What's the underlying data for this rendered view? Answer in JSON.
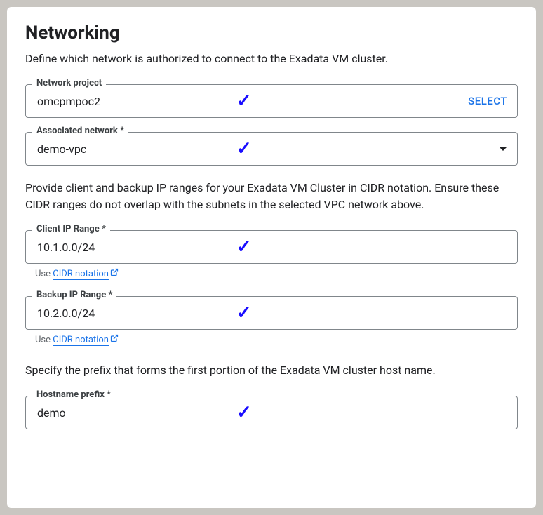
{
  "title": "Networking",
  "intro": "Define which network is authorized to connect to the Exadata VM cluster.",
  "fields": {
    "network_project": {
      "label": "Network project",
      "value": "omcpmpoc2",
      "action": "SELECT"
    },
    "associated_network": {
      "label": "Associated network *",
      "value": "demo-vpc"
    }
  },
  "cidr_intro": "Provide client and backup IP ranges for your Exadata VM Cluster in CIDR notation. Ensure these CIDR ranges do not overlap with the subnets in the selected VPC network above.",
  "client_ip": {
    "label": "Client IP Range *",
    "value": "10.1.0.0/24",
    "helper_prefix": "Use ",
    "helper_link": "CIDR notation"
  },
  "backup_ip": {
    "label": "Backup IP Range *",
    "value": "10.2.0.0/24",
    "helper_prefix": "Use ",
    "helper_link": "CIDR notation"
  },
  "hostname_intro": "Specify the prefix that forms the first portion of the Exadata VM cluster host name.",
  "hostname": {
    "label": "Hostname prefix *",
    "value": "demo"
  }
}
